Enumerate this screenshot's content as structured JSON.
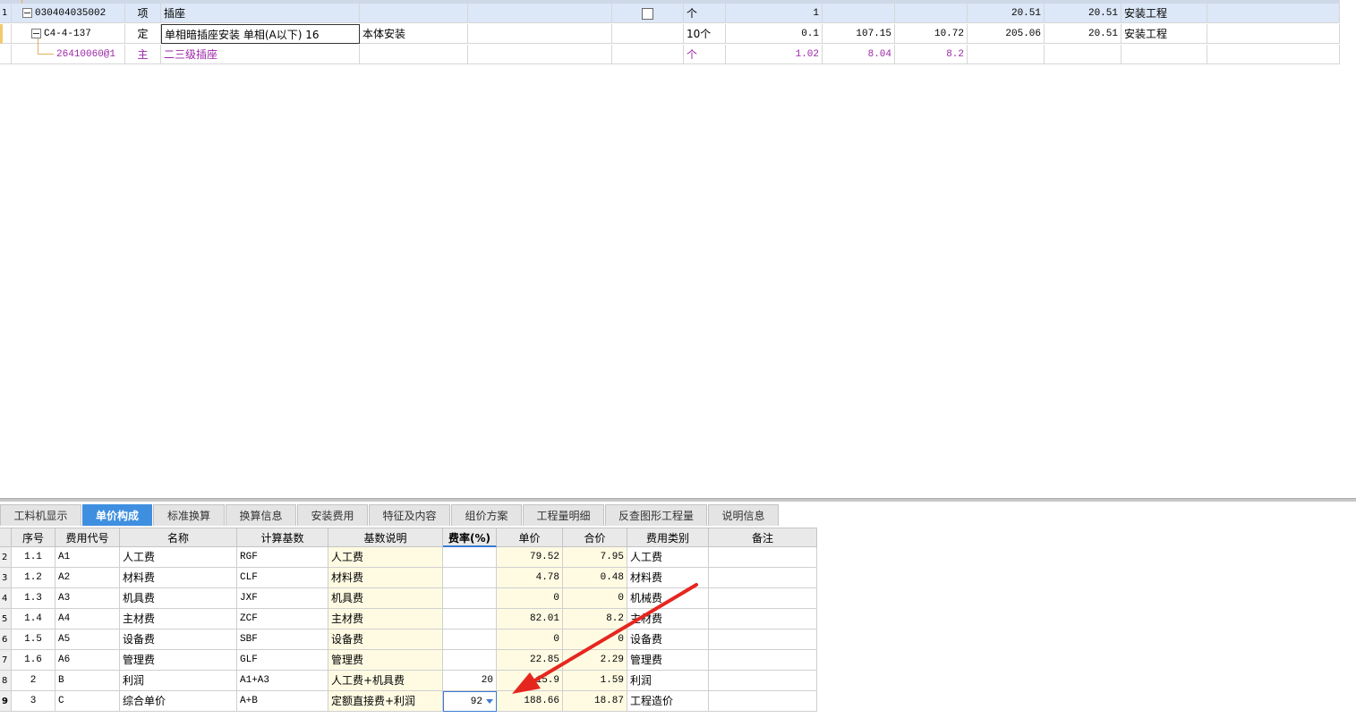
{
  "top_rows": [
    {
      "row_num": "1",
      "code": "030404035002",
      "type": "项",
      "name": "插座",
      "feature": "",
      "unit": "个",
      "qty": "1",
      "price": "",
      "total": "",
      "combined_price": "20.51",
      "combined_total": "20.51",
      "category": "安装工程"
    },
    {
      "row_num": "",
      "code": "C4-4-137",
      "type": "定",
      "name": "单相暗插座安装 单相(A以下) 16",
      "feature": "本体安装",
      "unit": "10个",
      "qty": "0.1",
      "price": "107.15",
      "total": "10.72",
      "combined_price": "205.06",
      "combined_total": "20.51",
      "category": "安装工程"
    },
    {
      "row_num": "",
      "code": "26410060@1",
      "type": "主",
      "name": "二三级插座",
      "feature": "",
      "unit": "个",
      "qty": "1.02",
      "price": "8.04",
      "total": "8.2",
      "combined_price": "",
      "combined_total": "",
      "category": ""
    }
  ],
  "tabs": [
    "工料机显示",
    "单价构成",
    "标准换算",
    "换算信息",
    "安装费用",
    "特征及内容",
    "组价方案",
    "工程量明细",
    "反查图形工程量",
    "说明信息"
  ],
  "active_tab": "单价构成",
  "bottom_headers": [
    "序号",
    "费用代号",
    "名称",
    "计算基数",
    "基数说明",
    "费率(%)",
    "单价",
    "合价",
    "费用类别",
    "备注"
  ],
  "bottom_rows": [
    {
      "rn": "2",
      "seq": "1.1",
      "code": "A1",
      "name": "人工费",
      "base": "RGF",
      "desc": "人工费",
      "rate": "",
      "price": "79.52",
      "total": "7.95",
      "cat": "人工费",
      "note": ""
    },
    {
      "rn": "3",
      "seq": "1.2",
      "code": "A2",
      "name": "材料费",
      "base": "CLF",
      "desc": "材料费",
      "rate": "",
      "price": "4.78",
      "total": "0.48",
      "cat": "材料费",
      "note": ""
    },
    {
      "rn": "4",
      "seq": "1.3",
      "code": "A3",
      "name": "机具费",
      "base": "JXF",
      "desc": "机具费",
      "rate": "",
      "price": "0",
      "total": "0",
      "cat": "机械费",
      "note": ""
    },
    {
      "rn": "5",
      "seq": "1.4",
      "code": "A4",
      "name": "主材费",
      "base": "ZCF",
      "desc": "主材费",
      "rate": "",
      "price": "82.01",
      "total": "8.2",
      "cat": "主材费",
      "note": ""
    },
    {
      "rn": "6",
      "seq": "1.5",
      "code": "A5",
      "name": "设备费",
      "base": "SBF",
      "desc": "设备费",
      "rate": "",
      "price": "0",
      "total": "0",
      "cat": "设备费",
      "note": ""
    },
    {
      "rn": "7",
      "seq": "1.6",
      "code": "A6",
      "name": "管理费",
      "base": "GLF",
      "desc": "管理费",
      "rate": "",
      "price": "22.85",
      "total": "2.29",
      "cat": "管理费",
      "note": ""
    },
    {
      "rn": "8",
      "seq": "2",
      "code": "B",
      "name": "利润",
      "base": "A1+A3",
      "desc": "人工费+机具费",
      "rate": "20",
      "price": "15.9",
      "total": "1.59",
      "cat": "利润",
      "note": ""
    },
    {
      "rn": "9",
      "seq": "3",
      "code": "C",
      "name": "综合单价",
      "base": "A+B",
      "desc": "定额直接费+利润",
      "rate": "92",
      "price": "188.66",
      "total": "18.87",
      "cat": "工程造价",
      "note": ""
    }
  ],
  "colors": {
    "accent": "#3f8fe0",
    "purple_row": "#9b27a8",
    "arrow": "#e5261f",
    "selected_row": "#dce8f8",
    "desc_bg": "#fffbe3"
  }
}
